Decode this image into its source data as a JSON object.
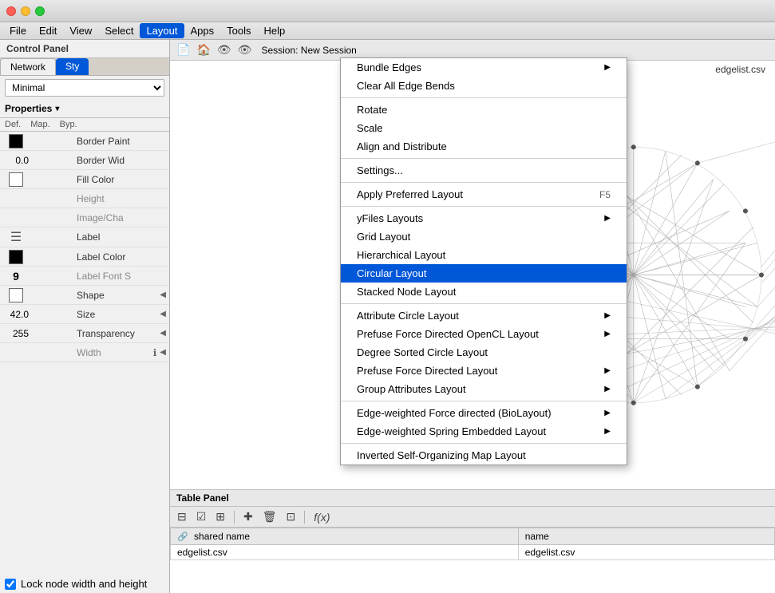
{
  "titleBar": {
    "title": ""
  },
  "menuBar": {
    "items": [
      {
        "id": "file",
        "label": "File"
      },
      {
        "id": "edit",
        "label": "Edit"
      },
      {
        "id": "view",
        "label": "View"
      },
      {
        "id": "select",
        "label": "Select"
      },
      {
        "id": "layout",
        "label": "Layout",
        "active": true
      },
      {
        "id": "apps",
        "label": "Apps"
      },
      {
        "id": "tools",
        "label": "Tools"
      },
      {
        "id": "help",
        "label": "Help"
      }
    ]
  },
  "leftPanel": {
    "controlPanelLabel": "Control Panel",
    "tabs": [
      {
        "id": "network",
        "label": "Network",
        "active": true
      },
      {
        "id": "style",
        "label": "Sty",
        "active": false
      }
    ],
    "minimalSelect": "Minimal",
    "propertiesLabel": "Properties",
    "propertyCols": {
      "def": "Def.",
      "map": "Map.",
      "byp": "Byp."
    },
    "properties": [
      {
        "def": "black-box",
        "map": "",
        "byp": "",
        "label": "Border Paint",
        "hasColor": true,
        "colorBlack": true
      },
      {
        "def": "0.0",
        "map": "",
        "byp": "",
        "label": "Border Wid",
        "isNum": true
      },
      {
        "def": "white-box",
        "map": "",
        "byp": "",
        "label": "Fill Color",
        "hasColor": true,
        "colorBlack": false
      },
      {
        "def": "",
        "map": "",
        "byp": "",
        "label": "Height",
        "isGray": true
      },
      {
        "def": "",
        "map": "",
        "byp": "",
        "label": "Image/Cha",
        "isGray": true
      },
      {
        "def": "arrow",
        "map": "",
        "byp": "",
        "label": "Label",
        "hasArrow": true
      },
      {
        "def": "black-box",
        "map": "",
        "byp": "",
        "label": "Label Color",
        "hasColor": true,
        "colorBlack": true
      },
      {
        "def": "",
        "map": "",
        "byp": "",
        "label": "Label Font S",
        "isGray": true
      },
      {
        "def": "shape-box",
        "map": "",
        "byp": "",
        "label": "Shape",
        "hasArrowRight": true
      },
      {
        "def": "42.0",
        "map": "",
        "byp": "",
        "label": "Size",
        "isNum": true,
        "hasArrowRight": true
      },
      {
        "def": "255",
        "map": "",
        "byp": "",
        "label": "Transparency",
        "isNum": true,
        "hasArrowRight": true
      },
      {
        "def": "",
        "map": "",
        "byp": "",
        "label": "Width",
        "isGray": true,
        "hasInfo": true,
        "hasArrowRight": true
      }
    ],
    "lockLabel": "Lock node width and height"
  },
  "rightPanel": {
    "sessionLabel": "Session: New Session",
    "networkFilename": "edgelist.csv"
  },
  "tablePanel": {
    "label": "Table Panel",
    "columns": [
      {
        "label": "shared name",
        "hasIcon": true
      },
      {
        "label": "name",
        "hasIcon": false
      }
    ],
    "rows": [
      {
        "sharedName": "edgelist.csv",
        "name": "edgelist.csv"
      }
    ]
  },
  "layoutMenu": {
    "items": [
      {
        "id": "bundle-edges",
        "label": "Bundle Edges",
        "hasSubmenu": true
      },
      {
        "id": "clear-bends",
        "label": "Clear All Edge Bends"
      },
      {
        "sep": true
      },
      {
        "id": "rotate",
        "label": "Rotate"
      },
      {
        "id": "scale",
        "label": "Scale"
      },
      {
        "id": "align-distribute",
        "label": "Align and Distribute"
      },
      {
        "sep": true
      },
      {
        "id": "settings",
        "label": "Settings..."
      },
      {
        "sep": true
      },
      {
        "id": "apply-preferred",
        "label": "Apply Preferred Layout",
        "shortcut": "F5"
      },
      {
        "sep": true
      },
      {
        "id": "yfiles",
        "label": "yFiles Layouts",
        "hasSubmenu": true
      },
      {
        "id": "grid",
        "label": "Grid Layout"
      },
      {
        "id": "hierarchical",
        "label": "Hierarchical Layout"
      },
      {
        "id": "circular",
        "label": "Circular Layout",
        "highlighted": true
      },
      {
        "id": "stacked-node",
        "label": "Stacked Node Layout"
      },
      {
        "sep": true
      },
      {
        "id": "attribute-circle",
        "label": "Attribute Circle Layout",
        "hasSubmenu": true
      },
      {
        "id": "prefuse-force-opencl",
        "label": "Prefuse Force Directed OpenCL Layout",
        "hasSubmenu": true
      },
      {
        "id": "degree-sorted",
        "label": "Degree Sorted Circle Layout"
      },
      {
        "id": "prefuse-force",
        "label": "Prefuse Force Directed Layout",
        "hasSubmenu": true
      },
      {
        "id": "group-attributes",
        "label": "Group Attributes Layout",
        "hasSubmenu": true
      },
      {
        "sep": true
      },
      {
        "id": "edge-weighted-biolayout",
        "label": "Edge-weighted Force directed (BioLayout)",
        "hasSubmenu": true
      },
      {
        "id": "edge-weighted-spring",
        "label": "Edge-weighted Spring Embedded Layout",
        "hasSubmenu": true
      },
      {
        "sep": true
      },
      {
        "id": "inverted-som",
        "label": "Inverted Self-Organizing Map Layout"
      }
    ]
  }
}
